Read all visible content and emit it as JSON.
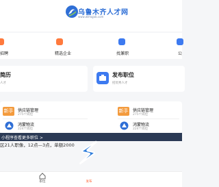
{
  "header": {
    "logo_text": "乌鲁木齐人才网",
    "logo_sub": "www.wlmqjob.com"
  },
  "quick_nav": [
    {
      "label": "招聘",
      "icon": "resume-icon",
      "color": "#ff7a3d"
    },
    {
      "label": "精选企业",
      "icon": "company-icon",
      "color": "#ff7a3d"
    },
    {
      "label": "找兼职",
      "icon": "parttime-icon",
      "color": "#3d7af0"
    },
    {
      "label": "公",
      "icon": "person-icon",
      "color": "#3d7af0"
    }
  ],
  "cards": {
    "resume": {
      "title": "简历",
      "sub": "人才"
    },
    "post": {
      "title": "发布职位",
      "sub": "招优秀人才"
    }
  },
  "jobs": [
    {
      "badge": "新手",
      "title": "供应链管理",
      "count": "275个岗位"
    },
    {
      "badge": "新手",
      "title": "供应链管理",
      "count": "275个岗位"
    },
    {
      "title": "鸿蒙物流",
      "count": "224个岗位"
    },
    {
      "title": "鸿蒙物流",
      "count": "224个岗位"
    }
  ],
  "promo_text": "小程序查看更多职位 >",
  "ticker_text": "区21人职像，12点—3点，单额2000",
  "tabbar": {
    "tabs": [
      {
        "label": "职位",
        "active": false
      },
      {
        "label": "发布",
        "active": true
      }
    ]
  },
  "colors": {
    "brand": "#2f6fd6",
    "orange": "#f39a3c",
    "accent": "#ff6a3d"
  }
}
